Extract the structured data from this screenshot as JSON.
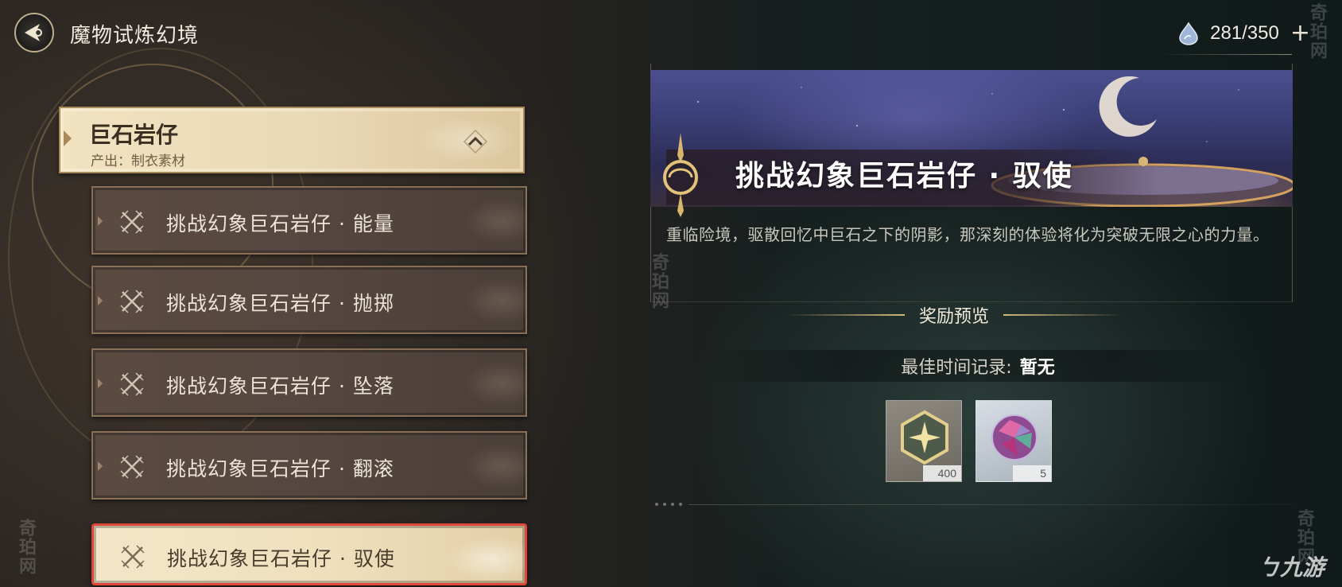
{
  "header": {
    "title": "魔物试炼幻境",
    "stamina": "281/350",
    "plus": "+"
  },
  "boss": {
    "name": "巨石岩仔",
    "output": "产出：制衣素材"
  },
  "challenges": [
    {
      "label": "挑战幻象巨石岩仔 · 能量",
      "selected": false
    },
    {
      "label": "挑战幻象巨石岩仔 · 抛掷",
      "selected": false
    },
    {
      "label": "挑战幻象巨石岩仔 · 坠落",
      "selected": false
    },
    {
      "label": "挑战幻象巨石岩仔 · 翻滚",
      "selected": false
    },
    {
      "label": "挑战幻象巨石岩仔 · 驭使",
      "selected": true
    }
  ],
  "detail": {
    "title": "挑战幻象巨石岩仔 · 驭使",
    "description": "重临险境，驱散回忆中巨石之下的阴影，那深刻的体验将化为突破无限之心的力量。",
    "reward_preview": "奖励预览",
    "best_time_label": "最佳时间记录:",
    "best_time_value": "暂无",
    "rewards": [
      {
        "icon": "gold-star-badge-icon",
        "quantity": "400"
      },
      {
        "icon": "crystal-orb-icon",
        "quantity": "5"
      }
    ]
  },
  "watermarks": {
    "site": "奇珀网",
    "logo": "九游"
  },
  "colors": {
    "selection_outline": "#e0473a",
    "card_cream": "#f1e2c1",
    "card_dark": "#564740"
  }
}
